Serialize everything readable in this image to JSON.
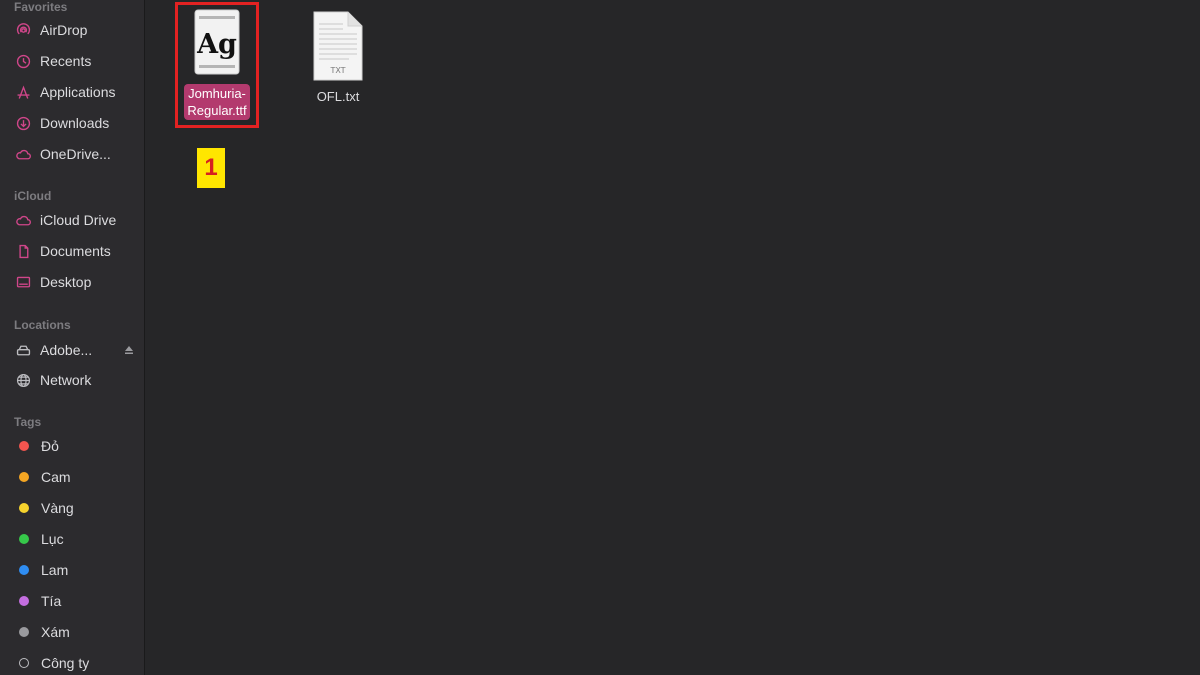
{
  "sidebar": {
    "favorites_label": "Favorites",
    "favorites": [
      {
        "label": "AirDrop",
        "icon": "airdrop-icon"
      },
      {
        "label": "Recents",
        "icon": "clock-icon"
      },
      {
        "label": "Applications",
        "icon": "applications-icon"
      },
      {
        "label": "Downloads",
        "icon": "download-icon"
      },
      {
        "label": "OneDrive...",
        "icon": "cloud-icon"
      }
    ],
    "icloud_label": "iCloud",
    "icloud": [
      {
        "label": "iCloud Drive",
        "icon": "cloud-icon"
      },
      {
        "label": "Documents",
        "icon": "document-icon"
      },
      {
        "label": "Desktop",
        "icon": "desktop-icon"
      }
    ],
    "locations_label": "Locations",
    "locations": [
      {
        "label": "Adobe...",
        "icon": "disk-icon"
      },
      {
        "label": "Network",
        "icon": "globe-icon"
      }
    ],
    "tags_label": "Tags",
    "tags": [
      {
        "label": "Đỏ",
        "color": "#f2554f"
      },
      {
        "label": "Cam",
        "color": "#f5a623"
      },
      {
        "label": "Vàng",
        "color": "#f6d32d"
      },
      {
        "label": "Lục",
        "color": "#36c84a"
      },
      {
        "label": "Lam",
        "color": "#2f8df2"
      },
      {
        "label": "Tía",
        "color": "#c46ee0"
      },
      {
        "label": "Xám",
        "color": "#9a9a9e"
      },
      {
        "label": "Công ty",
        "color": ""
      }
    ]
  },
  "files": [
    {
      "name": "Jomhuria-Regular.ttf",
      "icon_text": "Ag",
      "selected": true
    },
    {
      "name": "OFL.txt",
      "icon_text": "TXT",
      "selected": false
    }
  ],
  "annotation": {
    "step": "1"
  },
  "colors": {
    "accent": "#b33a6e",
    "highlight": "#e32222",
    "badge": "#ffe600",
    "sidebar_icon": "#d0468a"
  }
}
